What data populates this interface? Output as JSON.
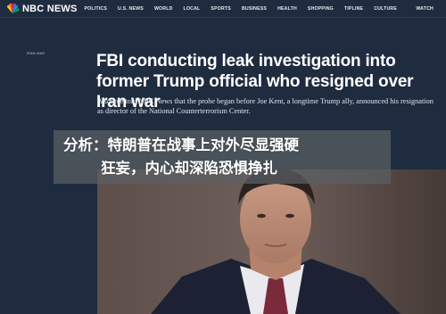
{
  "site": {
    "logo_text": "NBC NEWS",
    "nav": [
      "POLITICS",
      "U.S. NEWS",
      "WORLD",
      "LOCAL",
      "SPORTS",
      "BUSINESS",
      "HEALTH",
      "SHOPPING",
      "TIPLINE",
      "CULTURE"
    ],
    "watch_label": "WATCH"
  },
  "article": {
    "kicker": "IRAN WAR",
    "headline": "FBI conducting leak investigation into former Trump official who resigned over Iran war",
    "dek": "A source told NBC News that the probe began before Joe Kent, a longtime Trump ally, announced his resignation as director of the National Counterterrorism Center."
  },
  "overlay": {
    "line1": "分析：特朗普在战事上对外尽显强硬",
    "line2": "狂妄，内心却深陷恐惧挣扎"
  },
  "colors": {
    "page_bg": "#1f2c3f",
    "overlay_bg": "rgba(90,95,100,0.72)"
  }
}
